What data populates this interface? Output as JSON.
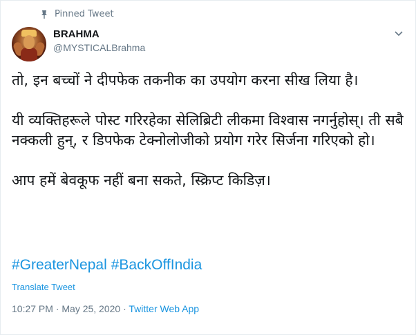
{
  "pinned_label": "Pinned Tweet",
  "author": {
    "name": "BRAHMA",
    "handle": "@MYSTICALBrahma"
  },
  "tweet": {
    "lines": [
      "तो, इन बच्चों ने दीपफेक तकनीक का उपयोग करना सीख लिया है।",
      "",
      "यी व्यक्तिहरूले पोस्ट गरिरहेका सेलिब्रिटी लीकमा विश्वास नगर्नुहोस्। ती सबै नक्कली हुन्, र डिपफेक टेक्नोलोजीको प्रयोग गरेर सिर्जना गरिएको हो।",
      "",
      "आप हमें बेवकूफ नहीं बना सकते, स्क्रिप्ट किडिज़।"
    ],
    "hashtags": [
      "#GreaterNepal",
      "#BackOffIndia"
    ]
  },
  "translate_label": "Translate Tweet",
  "timestamp": "10:27 PM · May 25, 2020 · ",
  "source_app": "Twitter Web App",
  "colors": {
    "link": "#1b95e0",
    "secondary": "#657786",
    "text": "#14171a"
  },
  "icons": {
    "pin": "pin-icon",
    "menu": "chevron-down-icon"
  }
}
